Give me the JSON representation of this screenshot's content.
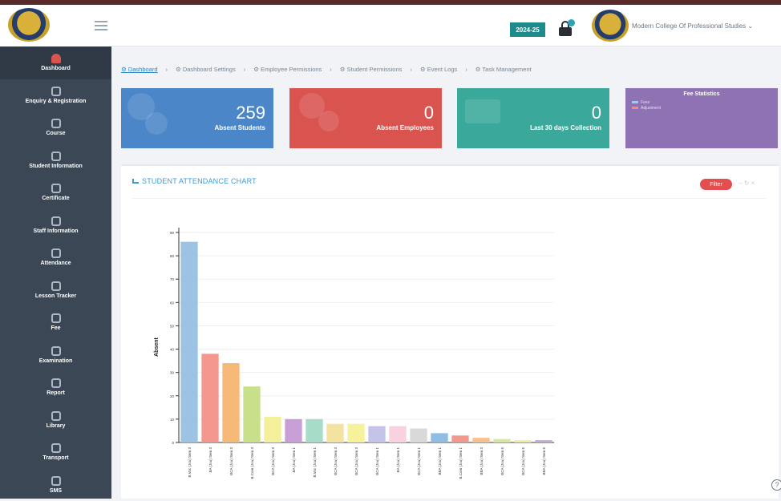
{
  "header": {
    "session_label": "2024-25",
    "college_name": "Modern College Of Professional Studies"
  },
  "sidebar": {
    "items": [
      {
        "label": "Dashboard",
        "icon": "home-icon",
        "active": true
      },
      {
        "label": "Enquiry & Registration",
        "icon": "users-icon"
      },
      {
        "label": "Course",
        "icon": "share-icon"
      },
      {
        "label": "Student Information",
        "icon": "users-icon"
      },
      {
        "label": "Certificate",
        "icon": "certificate-icon"
      },
      {
        "label": "Staff Information",
        "icon": "user-plus-icon"
      },
      {
        "label": "Attendance",
        "icon": "calendar-check-icon"
      },
      {
        "label": "Lesson Tracker",
        "icon": "calendar-icon"
      },
      {
        "label": "Fee",
        "icon": "money-icon"
      },
      {
        "label": "Examination",
        "icon": "edit-icon"
      },
      {
        "label": "Report",
        "icon": "file-icon"
      },
      {
        "label": "Library",
        "icon": "grid-icon"
      },
      {
        "label": "Transport",
        "icon": "bus-icon"
      },
      {
        "label": "SMS",
        "icon": "chat-icon"
      }
    ]
  },
  "breadcrumb": [
    "Dashboard",
    "Dashboard Settings",
    "Employee Permissions",
    "Student Permissions",
    "Event Logs",
    "Task Management"
  ],
  "cards": {
    "absent_students": {
      "value": "259",
      "label": "Absent Students"
    },
    "absent_employees": {
      "value": "0",
      "label": "Absent Employees"
    },
    "collection": {
      "value": "0",
      "label": "Last 30 days Collection"
    },
    "fee_statistics": {
      "title": "Fee Statistics",
      "legend": [
        "Fees",
        "Adjustment"
      ]
    }
  },
  "panel": {
    "title": "STUDENT ATTENDANCE CHART",
    "filter_label": "Filter"
  },
  "colors": {
    "sidebar": "#3b4754",
    "card_blue": "#4a86c8",
    "card_red": "#d9534f",
    "card_teal": "#3aa89a",
    "card_purple": "#8e72b4",
    "accent": "#3a9ad9"
  },
  "chart_data": {
    "type": "bar",
    "ylabel": "Absent",
    "ylim": [
      0,
      90
    ],
    "yticks": [
      0,
      10,
      20,
      30,
      40,
      50,
      60,
      70,
      80,
      90
    ],
    "categories": [
      "B.Voc (Jou) Sem 3",
      "BA (Jou) Sem 3",
      "BCA (Jou) Sem 3",
      "B.Com (Jou) Sem 3",
      "BCA (Jou) Sem 3",
      "BA (Jou) Sem 1",
      "B.Voc (Jou) Sem 1",
      "BCA (Jou) Sem 3",
      "BCA (Jou) Sem 3",
      "BCA (Jou) Sem 1",
      "BA (Jou) Sem 1",
      "BCA (Jou) Sem 1",
      "BBA (Jou) Sem 1",
      "B.Com (Jou) Sem 1",
      "BBA (Jou) Sem 3",
      "BCA (Jou) Sem 5",
      "BCA (Jou) Sem 5",
      "BBA (Jou) Sem 5"
    ],
    "values": [
      86,
      38,
      34,
      24,
      11,
      10,
      10,
      8,
      8,
      7,
      7,
      6,
      4,
      3,
      2,
      1.5,
      1,
      1
    ],
    "colors": [
      "#9cc3e4",
      "#f4978e",
      "#f7b977",
      "#c8e08a",
      "#f5ef9c",
      "#c79fd6",
      "#a7dcc9",
      "#f3e2a0",
      "#f6f29b",
      "#c5c3e8",
      "#f8d3df",
      "#d9d9d9",
      "#8fbde3",
      "#f2998f",
      "#f8c08a",
      "#d6e6a4",
      "#f3ec9c",
      "#c9a8d8"
    ]
  }
}
